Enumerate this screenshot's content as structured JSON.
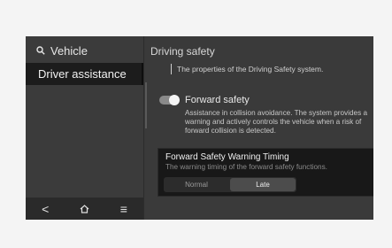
{
  "sidebar": {
    "search_label": "Vehicle",
    "selected_item": "Driver assistance",
    "nav": {
      "back_glyph": "<",
      "home_icon": "home-icon",
      "menu_glyph": "≡"
    }
  },
  "main": {
    "section_title": "Driving safety",
    "section_description": "The properties of the Driving Safety system.",
    "forward_safety": {
      "title": "Forward safety",
      "description": "Assistance in collision avoidance. The system provides a warning and actively controls the vehicle when a risk of  forward collision is detected.",
      "enabled": true
    }
  },
  "popup": {
    "title": "Forward Safety Warning Timing",
    "subtitle": "The warning timing of the forward safety functions.",
    "options": [
      "Normal",
      "Late"
    ],
    "selected": "Late"
  },
  "colors": {
    "screen_bg": "#3a3a3a",
    "selected_bg": "#1c1c1c",
    "popup_bg": "#181818"
  }
}
